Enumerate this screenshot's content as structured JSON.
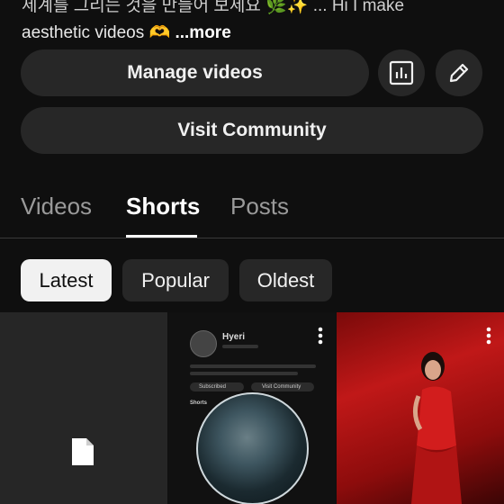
{
  "description": {
    "line1": "세계를 그리는 것을 만들어 보세요 🌿✨ ... Hi I make",
    "line2_text": "aesthetic videos 🫶",
    "more": "...more"
  },
  "actions": {
    "manage_videos": "Manage videos",
    "visit_community": "Visit Community",
    "analytics_icon": "analytics-icon",
    "edit_icon": "pencil-icon"
  },
  "tabs": [
    {
      "label": "Videos",
      "selected": false
    },
    {
      "label": "Shorts",
      "selected": true
    },
    {
      "label": "Posts",
      "selected": false
    }
  ],
  "filters": [
    {
      "label": "Latest",
      "selected": true
    },
    {
      "label": "Popular",
      "selected": false
    },
    {
      "label": "Oldest",
      "selected": false
    }
  ],
  "shorts": [
    {
      "thumbnail": "document-placeholder"
    },
    {
      "thumbnail": "profile-screenshot",
      "mini_name": "Hyeri",
      "mini_subscribed": "Subscribed",
      "mini_community": "Visit Community",
      "mini_tab": "Shorts"
    },
    {
      "thumbnail": "performer-red-dress"
    }
  ],
  "colors": {
    "background": "#0f0f0f",
    "button": "#272727",
    "selected_chip": "#f1f1f1",
    "muted_tab": "#9a9a9a"
  }
}
